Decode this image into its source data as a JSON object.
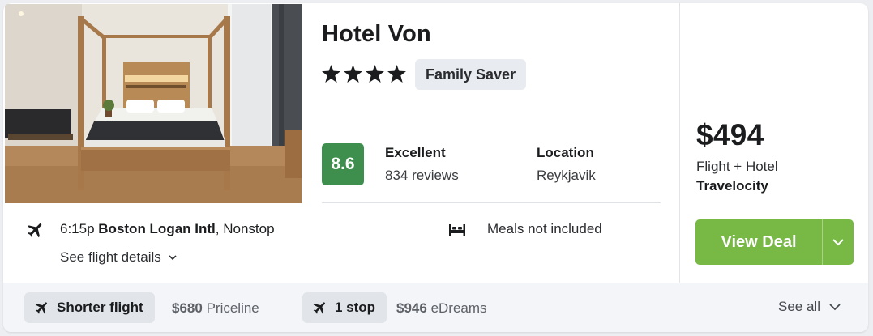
{
  "hotel": {
    "name": "Hotel Von",
    "star_rating": 4,
    "badge": "Family Saver"
  },
  "rating": {
    "score": "8.6",
    "label": "Excellent",
    "reviews": "834 reviews",
    "score_color": "#3e8f4d"
  },
  "location": {
    "label": "Location",
    "value": "Reykjavik"
  },
  "flight": {
    "time": "6:15p",
    "airport": "Boston Logan Intl",
    "stops": ", Nonstop",
    "details_link": "See flight details",
    "icon": "airplane-icon"
  },
  "meals": {
    "text": "Meals not included",
    "icon": "bed-icon"
  },
  "price": {
    "amount": "$494",
    "package_type": "Flight + Hotel",
    "provider": "Travelocity"
  },
  "deal_button": {
    "label": "View Deal",
    "color": "#78b946"
  },
  "alternatives": [
    {
      "tag": "Shorter flight",
      "price": "$680",
      "provider": "Priceline",
      "icon": "airplane-icon"
    },
    {
      "tag": "1 stop",
      "price": "$946",
      "provider": "eDreams",
      "icon": "airplane-icon"
    }
  ],
  "see_all": "See all"
}
